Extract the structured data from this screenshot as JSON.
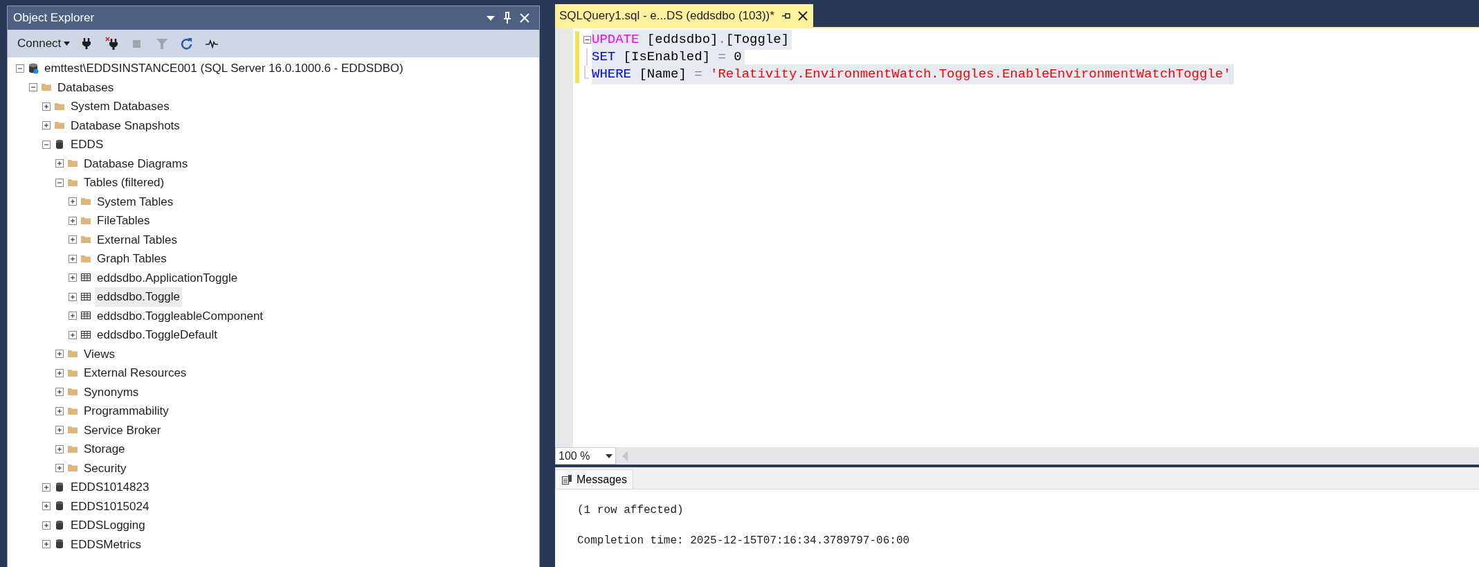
{
  "object_explorer": {
    "title": "Object Explorer",
    "toolbar": {
      "connect_label": "Connect",
      "buttons": [
        {
          "kind": "connect",
          "disabled": false
        },
        {
          "kind": "disconnect",
          "disabled": false
        },
        {
          "kind": "stop",
          "disabled": true
        },
        {
          "kind": "filter",
          "disabled": true
        },
        {
          "kind": "refresh",
          "disabled": false
        },
        {
          "kind": "activity",
          "disabled": false
        }
      ]
    },
    "tree": [
      {
        "label": "emttest\\EDDSINSTANCE001 (SQL Server 16.0.1000.6 - EDDSDBO)",
        "kind": "server",
        "expanded": true,
        "selected": false,
        "children": [
          {
            "label": "Databases",
            "kind": "folder",
            "expanded": true,
            "selected": false,
            "children": [
              {
                "label": "System Databases",
                "kind": "folder",
                "expanded": false,
                "selected": false
              },
              {
                "label": "Database Snapshots",
                "kind": "folder",
                "expanded": false,
                "selected": false
              },
              {
                "label": "EDDS",
                "kind": "database",
                "expanded": true,
                "selected": false,
                "children": [
                  {
                    "label": "Database Diagrams",
                    "kind": "folder",
                    "expanded": false,
                    "selected": false
                  },
                  {
                    "label": "Tables (filtered)",
                    "kind": "folder",
                    "expanded": true,
                    "selected": false,
                    "children": [
                      {
                        "label": "System Tables",
                        "kind": "folder",
                        "expanded": false,
                        "selected": false
                      },
                      {
                        "label": "FileTables",
                        "kind": "folder",
                        "expanded": false,
                        "selected": false
                      },
                      {
                        "label": "External Tables",
                        "kind": "folder",
                        "expanded": false,
                        "selected": false
                      },
                      {
                        "label": "Graph Tables",
                        "kind": "folder",
                        "expanded": false,
                        "selected": false
                      },
                      {
                        "label": "eddsdbo.ApplicationToggle",
                        "kind": "table",
                        "expanded": false,
                        "selected": false
                      },
                      {
                        "label": "eddsdbo.Toggle",
                        "kind": "table",
                        "expanded": false,
                        "selected": true
                      },
                      {
                        "label": "eddsdbo.ToggleableComponent",
                        "kind": "table",
                        "expanded": false,
                        "selected": false
                      },
                      {
                        "label": "eddsdbo.ToggleDefault",
                        "kind": "table",
                        "expanded": false,
                        "selected": false
                      }
                    ]
                  },
                  {
                    "label": "Views",
                    "kind": "folder",
                    "expanded": false,
                    "selected": false
                  },
                  {
                    "label": "External Resources",
                    "kind": "folder",
                    "expanded": false,
                    "selected": false
                  },
                  {
                    "label": "Synonyms",
                    "kind": "folder",
                    "expanded": false,
                    "selected": false
                  },
                  {
                    "label": "Programmability",
                    "kind": "folder",
                    "expanded": false,
                    "selected": false
                  },
                  {
                    "label": "Service Broker",
                    "kind": "folder",
                    "expanded": false,
                    "selected": false
                  },
                  {
                    "label": "Storage",
                    "kind": "folder",
                    "expanded": false,
                    "selected": false
                  },
                  {
                    "label": "Security",
                    "kind": "folder",
                    "expanded": false,
                    "selected": false
                  }
                ]
              },
              {
                "label": "EDDS1014823",
                "kind": "database",
                "expanded": false,
                "selected": false
              },
              {
                "label": "EDDS1015024",
                "kind": "database",
                "expanded": false,
                "selected": false
              },
              {
                "label": "EDDSLogging",
                "kind": "database",
                "expanded": false,
                "selected": false
              },
              {
                "label": "EDDSMetrics",
                "kind": "database",
                "expanded": false,
                "selected": false
              }
            ]
          }
        ]
      }
    ]
  },
  "editor": {
    "tab": {
      "title": "SQLQuery1.sql - e...DS (eddsdbo (103))*",
      "selected": true
    },
    "lines": [
      {
        "modified": true,
        "selected": true,
        "tokens": [
          {
            "text": "UPDATE",
            "kind": "dml"
          },
          {
            "text": " [eddsdbo]",
            "kind": "plain"
          },
          {
            "text": ".",
            "kind": "operator"
          },
          {
            "text": "[Toggle]",
            "kind": "plain"
          }
        ]
      },
      {
        "modified": true,
        "selected": true,
        "tokens": [
          {
            "text": "SET",
            "kind": "keyword"
          },
          {
            "text": " [IsEnabled] ",
            "kind": "plain"
          },
          {
            "text": "=",
            "kind": "operator"
          },
          {
            "text": " 0",
            "kind": "plain"
          }
        ]
      },
      {
        "modified": true,
        "selected": true,
        "tokens": [
          {
            "text": "WHERE",
            "kind": "keyword"
          },
          {
            "text": " [Name] ",
            "kind": "plain"
          },
          {
            "text": "=",
            "kind": "operator"
          },
          {
            "text": " 'Relativity.EnvironmentWatch.Toggles.EnableEnvironmentWatchToggle'",
            "kind": "string"
          }
        ]
      }
    ]
  },
  "zoom": {
    "value": "100 %"
  },
  "results": {
    "tabs": [
      {
        "label": "Messages",
        "selected": true
      }
    ],
    "messages": [
      "(1 row affected)",
      "Completion time: 2025-12-15T07:16:34.3789797-06:00"
    ]
  }
}
